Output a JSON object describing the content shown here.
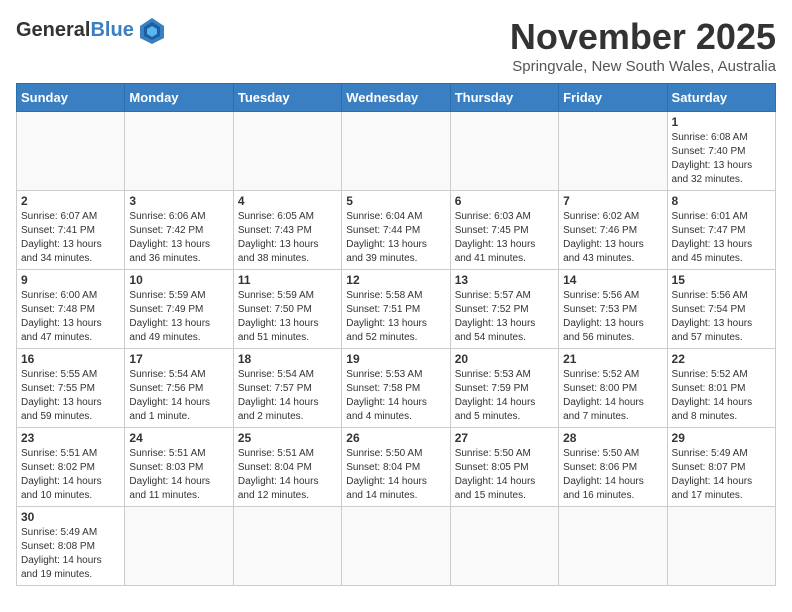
{
  "header": {
    "logo_general": "General",
    "logo_blue": "Blue",
    "month_title": "November 2025",
    "subtitle": "Springvale, New South Wales, Australia"
  },
  "weekdays": [
    "Sunday",
    "Monday",
    "Tuesday",
    "Wednesday",
    "Thursday",
    "Friday",
    "Saturday"
  ],
  "weeks": [
    [
      {
        "day": "",
        "info": ""
      },
      {
        "day": "",
        "info": ""
      },
      {
        "day": "",
        "info": ""
      },
      {
        "day": "",
        "info": ""
      },
      {
        "day": "",
        "info": ""
      },
      {
        "day": "",
        "info": ""
      },
      {
        "day": "1",
        "info": "Sunrise: 6:08 AM\nSunset: 7:40 PM\nDaylight: 13 hours\nand 32 minutes."
      }
    ],
    [
      {
        "day": "2",
        "info": "Sunrise: 6:07 AM\nSunset: 7:41 PM\nDaylight: 13 hours\nand 34 minutes."
      },
      {
        "day": "3",
        "info": "Sunrise: 6:06 AM\nSunset: 7:42 PM\nDaylight: 13 hours\nand 36 minutes."
      },
      {
        "day": "4",
        "info": "Sunrise: 6:05 AM\nSunset: 7:43 PM\nDaylight: 13 hours\nand 38 minutes."
      },
      {
        "day": "5",
        "info": "Sunrise: 6:04 AM\nSunset: 7:44 PM\nDaylight: 13 hours\nand 39 minutes."
      },
      {
        "day": "6",
        "info": "Sunrise: 6:03 AM\nSunset: 7:45 PM\nDaylight: 13 hours\nand 41 minutes."
      },
      {
        "day": "7",
        "info": "Sunrise: 6:02 AM\nSunset: 7:46 PM\nDaylight: 13 hours\nand 43 minutes."
      },
      {
        "day": "8",
        "info": "Sunrise: 6:01 AM\nSunset: 7:47 PM\nDaylight: 13 hours\nand 45 minutes."
      }
    ],
    [
      {
        "day": "9",
        "info": "Sunrise: 6:00 AM\nSunset: 7:48 PM\nDaylight: 13 hours\nand 47 minutes."
      },
      {
        "day": "10",
        "info": "Sunrise: 5:59 AM\nSunset: 7:49 PM\nDaylight: 13 hours\nand 49 minutes."
      },
      {
        "day": "11",
        "info": "Sunrise: 5:59 AM\nSunset: 7:50 PM\nDaylight: 13 hours\nand 51 minutes."
      },
      {
        "day": "12",
        "info": "Sunrise: 5:58 AM\nSunset: 7:51 PM\nDaylight: 13 hours\nand 52 minutes."
      },
      {
        "day": "13",
        "info": "Sunrise: 5:57 AM\nSunset: 7:52 PM\nDaylight: 13 hours\nand 54 minutes."
      },
      {
        "day": "14",
        "info": "Sunrise: 5:56 AM\nSunset: 7:53 PM\nDaylight: 13 hours\nand 56 minutes."
      },
      {
        "day": "15",
        "info": "Sunrise: 5:56 AM\nSunset: 7:54 PM\nDaylight: 13 hours\nand 57 minutes."
      }
    ],
    [
      {
        "day": "16",
        "info": "Sunrise: 5:55 AM\nSunset: 7:55 PM\nDaylight: 13 hours\nand 59 minutes."
      },
      {
        "day": "17",
        "info": "Sunrise: 5:54 AM\nSunset: 7:56 PM\nDaylight: 14 hours\nand 1 minute."
      },
      {
        "day": "18",
        "info": "Sunrise: 5:54 AM\nSunset: 7:57 PM\nDaylight: 14 hours\nand 2 minutes."
      },
      {
        "day": "19",
        "info": "Sunrise: 5:53 AM\nSunset: 7:58 PM\nDaylight: 14 hours\nand 4 minutes."
      },
      {
        "day": "20",
        "info": "Sunrise: 5:53 AM\nSunset: 7:59 PM\nDaylight: 14 hours\nand 5 minutes."
      },
      {
        "day": "21",
        "info": "Sunrise: 5:52 AM\nSunset: 8:00 PM\nDaylight: 14 hours\nand 7 minutes."
      },
      {
        "day": "22",
        "info": "Sunrise: 5:52 AM\nSunset: 8:01 PM\nDaylight: 14 hours\nand 8 minutes."
      }
    ],
    [
      {
        "day": "23",
        "info": "Sunrise: 5:51 AM\nSunset: 8:02 PM\nDaylight: 14 hours\nand 10 minutes."
      },
      {
        "day": "24",
        "info": "Sunrise: 5:51 AM\nSunset: 8:03 PM\nDaylight: 14 hours\nand 11 minutes."
      },
      {
        "day": "25",
        "info": "Sunrise: 5:51 AM\nSunset: 8:04 PM\nDaylight: 14 hours\nand 12 minutes."
      },
      {
        "day": "26",
        "info": "Sunrise: 5:50 AM\nSunset: 8:04 PM\nDaylight: 14 hours\nand 14 minutes."
      },
      {
        "day": "27",
        "info": "Sunrise: 5:50 AM\nSunset: 8:05 PM\nDaylight: 14 hours\nand 15 minutes."
      },
      {
        "day": "28",
        "info": "Sunrise: 5:50 AM\nSunset: 8:06 PM\nDaylight: 14 hours\nand 16 minutes."
      },
      {
        "day": "29",
        "info": "Sunrise: 5:49 AM\nSunset: 8:07 PM\nDaylight: 14 hours\nand 17 minutes."
      }
    ],
    [
      {
        "day": "30",
        "info": "Sunrise: 5:49 AM\nSunset: 8:08 PM\nDaylight: 14 hours\nand 19 minutes."
      },
      {
        "day": "",
        "info": ""
      },
      {
        "day": "",
        "info": ""
      },
      {
        "day": "",
        "info": ""
      },
      {
        "day": "",
        "info": ""
      },
      {
        "day": "",
        "info": ""
      },
      {
        "day": "",
        "info": ""
      }
    ]
  ]
}
